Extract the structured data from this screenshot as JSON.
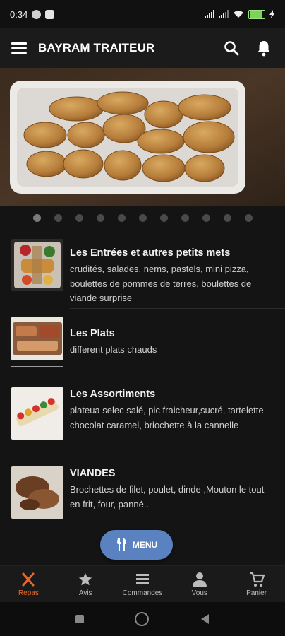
{
  "status_bar": {
    "time": "0:34",
    "battery": "100"
  },
  "app_bar": {
    "title": "BAYRAM TRAITEUR"
  },
  "carousel": {
    "count": 11,
    "active_index": 0
  },
  "categories": [
    {
      "title": "Les Entrées et autres petits mets",
      "description": "crudités, salades, nems, pastels, mini pizza, boulettes de pommes de terres, boulettes de viande surprise"
    },
    {
      "title": "Les Plats",
      "description": "different plats chauds"
    },
    {
      "title": "Les Assortiments",
      "description": "plateua selec salé, pic fraicheur,sucré, tartelette chocolat caramel, briochette à la cannelle"
    },
    {
      "title": "VIANDES",
      "description": "Brochettes de filet, poulet, dinde ,Mouton le tout en frit, four, panné.."
    }
  ],
  "menu_button": {
    "label": "MENU",
    "icon": "fork-knife-icon"
  },
  "bottom_nav": [
    {
      "label": "Repas",
      "icon": "fork-knife-icon",
      "active": true
    },
    {
      "label": "Avis",
      "icon": "star-icon",
      "active": false
    },
    {
      "label": "Commandes",
      "icon": "list-icon",
      "active": false
    },
    {
      "label": "Vous",
      "icon": "person-icon",
      "active": false
    },
    {
      "label": "Panier",
      "icon": "cart-icon",
      "active": false
    }
  ],
  "colors": {
    "accent": "#e8672a",
    "fab": "#5b82c0",
    "background": "#141414"
  }
}
